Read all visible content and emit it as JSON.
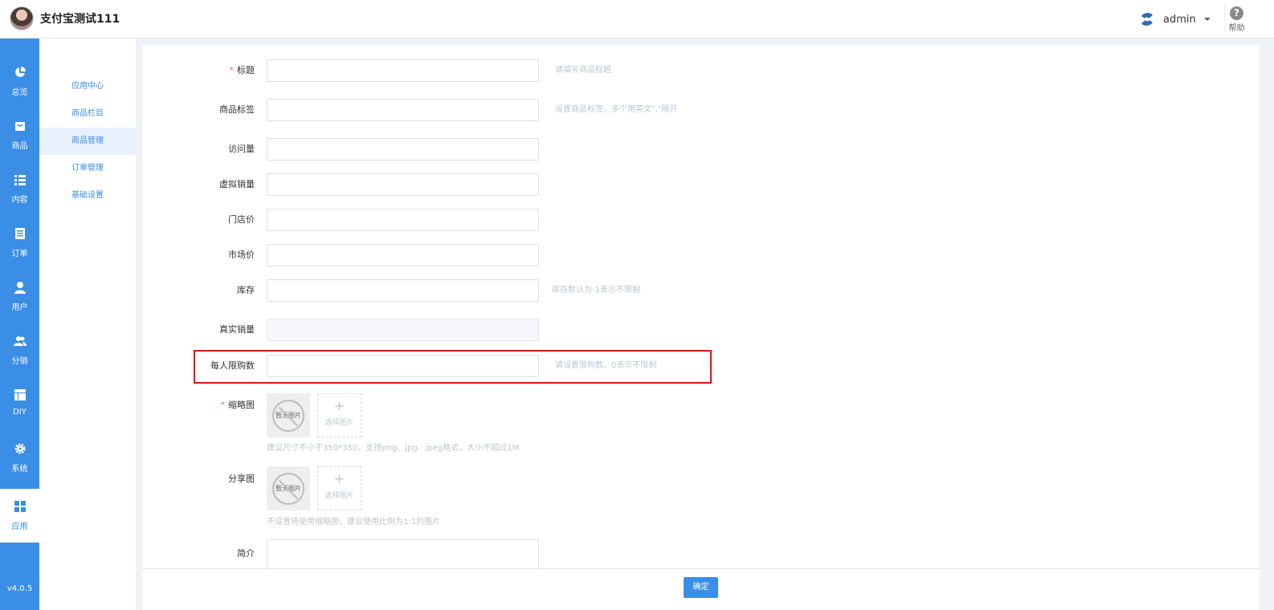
{
  "header": {
    "brand_name": "支付宝测试111",
    "user_name": "admin",
    "help_label": "帮助"
  },
  "sidenav": {
    "items": [
      {
        "label": "总览",
        "icon": "pie-chart-icon"
      },
      {
        "label": "商品",
        "icon": "shop-icon"
      },
      {
        "label": "内容",
        "icon": "list-icon"
      },
      {
        "label": "订单",
        "icon": "document-icon"
      },
      {
        "label": "用户",
        "icon": "user-icon"
      },
      {
        "label": "分销",
        "icon": "users-icon"
      },
      {
        "label": "DIY",
        "icon": "layout-icon"
      },
      {
        "label": "系统",
        "icon": "gear-icon"
      },
      {
        "label": "应用",
        "icon": "grid-icon"
      }
    ],
    "active_index": 8,
    "version": "v4.0.5"
  },
  "submenu": {
    "items": [
      "应用中心",
      "商品栏目",
      "商品管理",
      "订单管理",
      "基础设置"
    ],
    "active_index": 2
  },
  "form": {
    "title": {
      "label": "标题",
      "hint": "请填写商品标题"
    },
    "tags": {
      "label": "商品标签",
      "hint": "设置商品标签，多个用英文\",\"隔开"
    },
    "views": {
      "label": "访问量"
    },
    "virtual_sales": {
      "label": "虚拟销量"
    },
    "store_price": {
      "label": "门店价"
    },
    "market_price": {
      "label": "市场价"
    },
    "stock": {
      "label": "库存",
      "hint": "库存默认为-1表示不限制"
    },
    "real_sales": {
      "label": "真实销量"
    },
    "purchase_limit": {
      "label": "每人限购数",
      "hint": "请设置限购数，0表示不限制"
    },
    "thumbnail": {
      "label": "缩略图",
      "no_image": "暂无图片",
      "select": "选择图片",
      "hint": "建议尺寸不小于350*350，支持png、jpg、jpeg格式，大小不超过1M"
    },
    "share_image": {
      "label": "分享图",
      "no_image": "暂无图片",
      "select": "选择图片",
      "hint": "不设置将使用缩略图，建议使用比例为1:1的图片"
    },
    "intro": {
      "label": "简介"
    }
  },
  "footer": {
    "confirm_label": "确定"
  },
  "colors": {
    "primary": "#3a8ee6",
    "highlight_border": "#e5141b",
    "required": "#f56c6c"
  }
}
